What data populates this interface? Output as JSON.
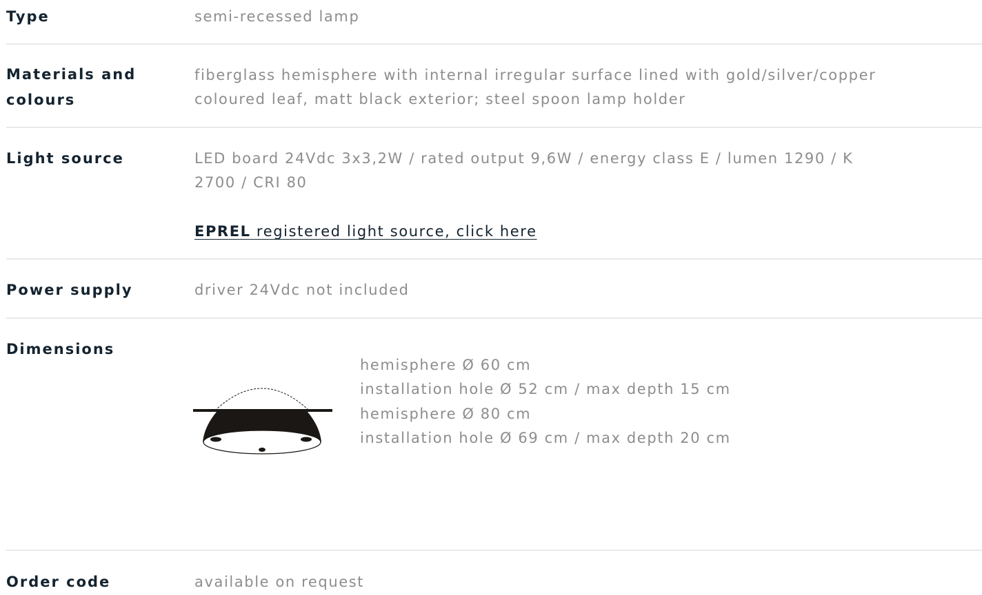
{
  "rows": {
    "type": {
      "label": "Type",
      "value": "semi-recessed lamp"
    },
    "materials": {
      "label_line1": "Materials and",
      "label_line2": "colours",
      "value_line1": "fiberglass hemisphere with internal irregular surface lined with gold/silver/copper",
      "value_line2": "coloured leaf, matt black exterior; steel spoon lamp holder"
    },
    "light_source": {
      "label": "Light source",
      "value_line1": "LED board 24Vdc 3x3,2W / rated output 9,6W / energy class E / lumen 1290 / K",
      "value_line2": "2700 / CRI 80",
      "link_bold": "EPREL",
      "link_text": " registered light source, click here"
    },
    "power_supply": {
      "label": "Power supply",
      "value": "driver 24Vdc not included"
    },
    "dimensions": {
      "label": "Dimensions",
      "lines": [
        "hemisphere Ø 60 cm",
        "installation hole Ø 52 cm / max depth 15 cm",
        "hemisphere Ø 80 cm",
        "installation hole Ø 69 cm / max depth 20 cm"
      ]
    },
    "order_code": {
      "label": "Order code",
      "value": "available on request"
    }
  },
  "icons": {
    "dimension_drawing": "semi-recessed-hemisphere-lamp-drawing"
  },
  "colors": {
    "label": "#14232f",
    "value": "#8d8d8d",
    "divider": "#e9e9e9",
    "drawing": "#1a1714"
  }
}
